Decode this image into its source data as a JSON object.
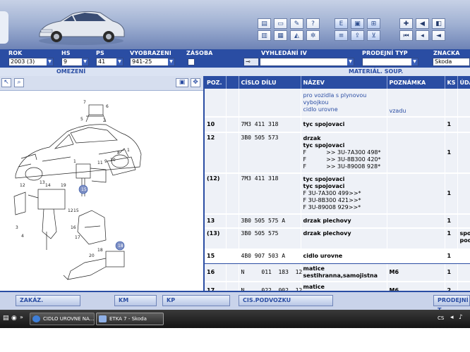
{
  "app": {
    "title": "ETKA 7 - Skoda"
  },
  "filters": {
    "rok": {
      "label": "ROK",
      "value": "2003 (3)"
    },
    "hs": {
      "label": "HS",
      "value": "9"
    },
    "ps": {
      "label": "PS",
      "value": "41"
    },
    "vyobrazeni": {
      "label": "VYOBRAZENI",
      "value": "941-25"
    },
    "zasoba": {
      "label": "ZÁSOBA"
    },
    "vyhledani": {
      "label": "VYHLEDÁNÍ IV",
      "value": ""
    },
    "prodejni": {
      "label": "PRODEJNÍ TYP",
      "value": ""
    },
    "znacka": {
      "label": "ZNACKA",
      "value": "Skoda"
    }
  },
  "subbar": {
    "left": "OMEZENÍ",
    "right": "MATERIÁL. SOUP."
  },
  "diagram": {
    "labels": [
      "7",
      "5",
      "2",
      "6",
      "8",
      "1",
      "10",
      "9",
      "1",
      "11",
      "12",
      "12",
      "13",
      "14",
      "19",
      "15",
      "16",
      "17",
      "18",
      "3",
      "4",
      "20"
    ],
    "callouts": [
      "15",
      "18"
    ]
  },
  "table": {
    "columns": [
      "POZ.",
      "",
      "CÍSLO DÍLU",
      "NÁZEV",
      "POZNÁMKA",
      "KS",
      "ÚDA"
    ],
    "header_row": {
      "name_lines": [
        "pro vozidla s plynovou",
        "vybojkou",
        "cidlo urovne"
      ],
      "note": "vzadu"
    },
    "rows": [
      {
        "poz": "10",
        "code": "7M3  411  318",
        "name": [
          "tyc spojovaci"
        ],
        "note": "",
        "ks": "1",
        "extra": ""
      },
      {
        "poz": "12",
        "code": "3B0  505  573",
        "name": [
          "drzak",
          "tyc spojovaci",
          "F           >> 3U-7A300 498*",
          "F           >> 3U-8B300 420*",
          "F           >> 3U-89008 928*"
        ],
        "note": "",
        "ks": "1",
        "extra": ""
      },
      {
        "poz": "(12)",
        "code": "7M3  411  318",
        "name": [
          "tyc spojovaci",
          "tyc spojovaci",
          "F 3U-7A300 499>>*",
          "F 3U-8B300 421>>*",
          "F 3U-89008 929>>*"
        ],
        "note": "",
        "ks": "1",
        "extra": ""
      },
      {
        "poz": "13",
        "code": "3B0  505  575  A",
        "name": [
          "drzak plechovy"
        ],
        "note": "",
        "ks": "1",
        "extra": ""
      },
      {
        "poz": "(13)",
        "code": "3B0  505  575",
        "name": [
          "drzak plechovy"
        ],
        "note": "",
        "ks": "1",
        "extra": [
          "spo",
          "pod"
        ]
      },
      {
        "poz": "15",
        "code": "4B0  907  503  A",
        "name": [
          "cidlo urovne"
        ],
        "note": "",
        "ks": "1",
        "extra": ""
      },
      {
        "poz": "16",
        "code": "N     011  183  12",
        "name": [
          "matice sestihranna,samojistna"
        ],
        "note": "M6",
        "ks": "1",
        "extra": ""
      },
      {
        "poz": "17",
        "code": "N     022  002  12",
        "name": [
          "matice sestihranna,samojistna"
        ],
        "note": "M6",
        "ks": "2",
        "extra": ""
      }
    ]
  },
  "bottom": {
    "zakaz": "ZAKÁZ.",
    "km": "KM",
    "kp": "KP",
    "cis": "CIS.PODVOZKU",
    "prodejni": "PRODEJNÍ T"
  },
  "taskbar": {
    "task1": "CIDLO UROVNE NA...",
    "task2": "ETKA 7 - Skoda",
    "lang": "CS"
  },
  "colors": {
    "accent": "#2a4da3",
    "row_bg": "#eef1f7",
    "header_grad": "#9fb0d2"
  }
}
